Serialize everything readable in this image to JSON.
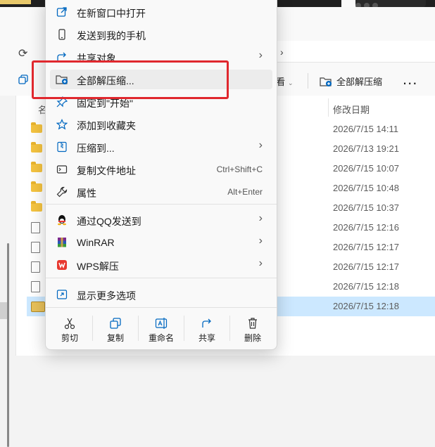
{
  "explorer": {
    "toolbar": {
      "view_label": "看",
      "extract_all_label": "全部解压缩",
      "more_label": "..."
    },
    "columns": {
      "name_stub": "名",
      "date_modified": "修改日期"
    },
    "rows": [
      {
        "type": "folder",
        "date": "2026/7/15 14:11"
      },
      {
        "type": "folder",
        "date": "2026/7/13 19:21"
      },
      {
        "type": "folder",
        "date": "2026/7/15 10:07"
      },
      {
        "type": "folder",
        "date": "2026/7/15 10:48"
      },
      {
        "type": "folder",
        "date": "2026/7/15 10:37"
      },
      {
        "type": "file",
        "date": "2026/7/15 12:16"
      },
      {
        "type": "file",
        "date": "2026/7/15 12:17"
      },
      {
        "type": "file",
        "date": "2026/7/15 12:17"
      },
      {
        "type": "file",
        "date": "2026/7/15 12:18"
      },
      {
        "type": "zip",
        "date": "2026/7/15 12:18",
        "selected": true
      }
    ]
  },
  "context_menu": {
    "items": [
      {
        "label": "在新窗口中打开",
        "icon": "open-new-window-icon"
      },
      {
        "label": "发送到我的手机",
        "icon": "phone-icon"
      },
      {
        "label": "共享对象",
        "icon": "share-icon",
        "submenu": true
      },
      {
        "label": "全部解压缩...",
        "icon": "extract-folder-icon",
        "highlighted": true
      },
      {
        "label": "固定到\"开始\"",
        "icon": "pin-icon"
      },
      {
        "label": "添加到收藏夹",
        "icon": "star-icon"
      },
      {
        "label": "压缩到...",
        "icon": "zip-icon",
        "submenu": true
      },
      {
        "label": "复制文件地址",
        "icon": "copy-path-icon",
        "shortcut": "Ctrl+Shift+C"
      },
      {
        "label": "属性",
        "icon": "wrench-icon",
        "shortcut": "Alt+Enter"
      },
      {
        "label": "通过QQ发送到",
        "icon": "qq-icon",
        "submenu": true
      },
      {
        "label": "WinRAR",
        "icon": "winrar-icon",
        "submenu": true
      },
      {
        "label": "WPS解压",
        "icon": "wps-icon",
        "submenu": true
      },
      {
        "label": "显示更多选项",
        "icon": "more-options-icon"
      }
    ],
    "bottom_actions": [
      {
        "label": "剪切",
        "icon": "scissors-icon"
      },
      {
        "label": "复制",
        "icon": "copy-icon"
      },
      {
        "label": "重命名",
        "icon": "rename-icon"
      },
      {
        "label": "共享",
        "icon": "share-icon"
      },
      {
        "label": "删除",
        "icon": "trash-icon"
      }
    ]
  },
  "colors": {
    "highlight_border": "#e0282e",
    "accent_blue": "#0067c0",
    "selected_row": "#cce8ff"
  }
}
